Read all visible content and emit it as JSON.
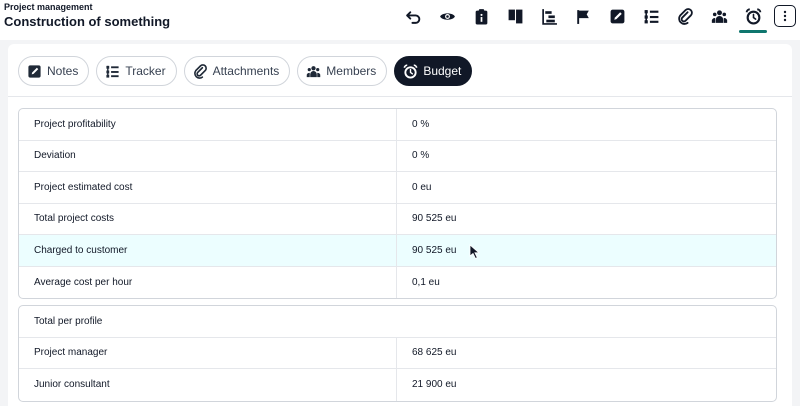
{
  "header": {
    "breadcrumb": "Project management",
    "title": "Construction of something"
  },
  "toolbar": [
    {
      "icon": "undo-icon"
    },
    {
      "icon": "eye-icon"
    },
    {
      "icon": "clipboard-info-icon"
    },
    {
      "icon": "kanban-icon"
    },
    {
      "icon": "gantt-icon"
    },
    {
      "icon": "flag-icon"
    },
    {
      "icon": "edit-icon"
    },
    {
      "icon": "tasks-icon"
    },
    {
      "icon": "paperclip-icon"
    },
    {
      "icon": "users-icon"
    },
    {
      "icon": "alarm-clock-icon",
      "active": true
    },
    {
      "icon": "more-vertical-icon"
    }
  ],
  "tabs": [
    {
      "label": "Notes",
      "icon": "edit-icon"
    },
    {
      "label": "Tracker",
      "icon": "tasks-icon"
    },
    {
      "label": "Attachments",
      "icon": "paperclip-icon"
    },
    {
      "label": "Members",
      "icon": "users-icon"
    },
    {
      "label": "Budget",
      "icon": "alarm-clock-icon",
      "active": true
    }
  ],
  "budget": {
    "rows": [
      {
        "label": "Project profitability",
        "value": "0 %"
      },
      {
        "label": "Deviation",
        "value": "0 %"
      },
      {
        "label": "Project estimated cost",
        "value": "0 eu"
      },
      {
        "label": "Total project costs",
        "value": "90 525 eu"
      },
      {
        "label": "Charged to customer",
        "value": "90 525 eu"
      },
      {
        "label": "Average cost per hour",
        "value": "0,1 eu"
      }
    ]
  },
  "profiles": {
    "title": "Total per profile",
    "rows": [
      {
        "label": "Project manager",
        "value": "68 625 eu"
      },
      {
        "label": "Junior consultant",
        "value": "21 900 eu"
      }
    ]
  },
  "colors": {
    "accent": "#0f766e",
    "active_tab": "#111827",
    "row_highlight": "#ecfeff"
  }
}
